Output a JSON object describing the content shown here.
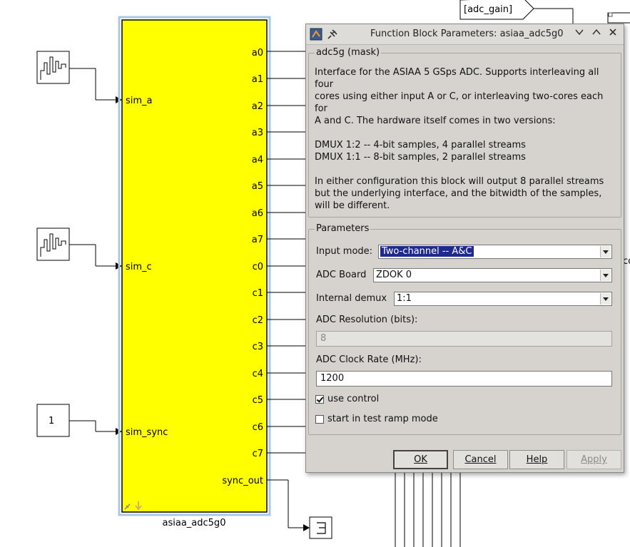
{
  "canvas": {
    "block_name": "asiaa_adc5g0",
    "input_ports": [
      "sim_a",
      "sim_c",
      "sim_sync"
    ],
    "output_ports": [
      "a0",
      "a1",
      "a2",
      "a3",
      "a4",
      "a5",
      "a6",
      "a7",
      "c0",
      "c1",
      "c2",
      "c3",
      "c4",
      "c5",
      "c6",
      "c7",
      "sync_out"
    ],
    "constant_value": "1",
    "goto_label": "[adc_gain]",
    "right_edge_fragment": "cc",
    "block_color": "#ffff00"
  },
  "dialog": {
    "title": "Function Block Parameters: asiaa_adc5g0",
    "mask_group": "adc5g (mask)",
    "description_lines": [
      "Interface for the ASIAA 5 GSps ADC. Supports interleaving all",
      "four",
      "cores using either input A or C, or interleaving two-cores each",
      "for",
      "A and C. The hardware itself comes in two versions:",
      "",
      "DMUX 1:2 -- 4-bit samples, 4 parallel streams",
      "DMUX 1:1 -- 8-bit samples, 2 parallel streams",
      "",
      "In either configuration this block will output 8 parallel streams",
      "but the underlying interface, and the bitwidth of the samples,",
      "will be different."
    ],
    "params_group": "Parameters",
    "input_mode_label": "Input mode:",
    "input_mode_value": "Two-channel -- A&C",
    "adc_board_label": "ADC Board",
    "adc_board_value": "ZDOK 0",
    "internal_demux_label": "Internal demux",
    "internal_demux_value": "1:1",
    "resolution_label": "ADC Resolution (bits):",
    "resolution_value": "8",
    "clock_label": "ADC Clock Rate (MHz):",
    "clock_value": "1200",
    "use_control_label": "use control",
    "use_control_checked": true,
    "test_ramp_label": "start in test ramp mode",
    "test_ramp_checked": false,
    "buttons": {
      "ok": "OK",
      "cancel": "Cancel",
      "help": "Help",
      "apply": "Apply"
    },
    "icons": [
      "matlab-icon",
      "pin-icon",
      "chevron-down-icon",
      "chevron-up-icon",
      "close-icon"
    ]
  }
}
